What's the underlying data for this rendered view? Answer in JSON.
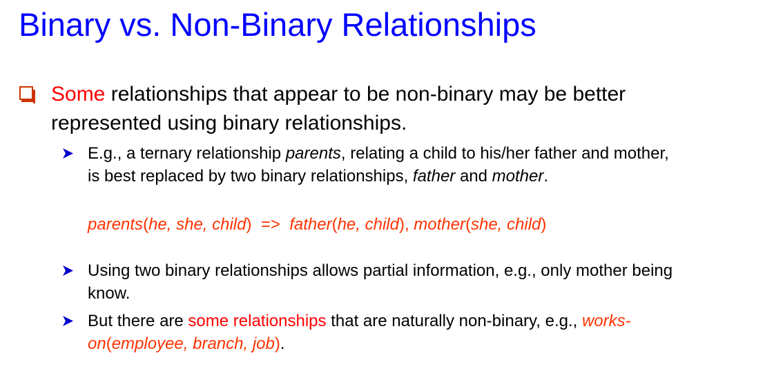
{
  "slide": {
    "title": "Binary vs. Non-Binary Relationships",
    "bullet1": {
      "highlight": "Some",
      "rest_line1": " relationships that appear to be non-binary may be better",
      "line2": "represented using binary relationships."
    },
    "sub1": {
      "t1": "E.g., a ternary relationship ",
      "em_parents": "parents",
      "t2": ", relating a child to his/her father and mother,",
      "t3": "is best replaced by two binary relationships, ",
      "em_father": "father",
      "t4": " and ",
      "em_mother": "mother",
      "t5": "."
    },
    "formula": {
      "f1": "parents",
      "f2": "(",
      "f3": "he, she, child",
      "f4": ")  =>  ",
      "f5": "father",
      "f6": "(",
      "f7": "he, child",
      "f8": "), ",
      "f9": "mother",
      "f10": "(",
      "f11": "she, child",
      "f12": ")"
    },
    "sub2": {
      "line1": "Using two binary relationships allows partial information, e.g., only mother being",
      "line2": "know."
    },
    "sub3": {
      "t1": "But there are ",
      "highlight": "some relationships",
      "t2": " that are naturally non-binary, e.g., ",
      "em_works": "works-",
      "em_on": "on",
      "p1": "(",
      "em_args": "employee, branch, job",
      "p2": ")",
      "t3": "."
    },
    "colors": {
      "title": "#0000ff",
      "bullet_box": "#cc3300",
      "arrow": "#0000cc",
      "highlight_red": "#ff0000",
      "highlight_orange": "#ff3300"
    },
    "icons": {
      "level1_bullet": "hollow-square-box-icon",
      "level2_bullet": "arrowhead-icon"
    }
  }
}
